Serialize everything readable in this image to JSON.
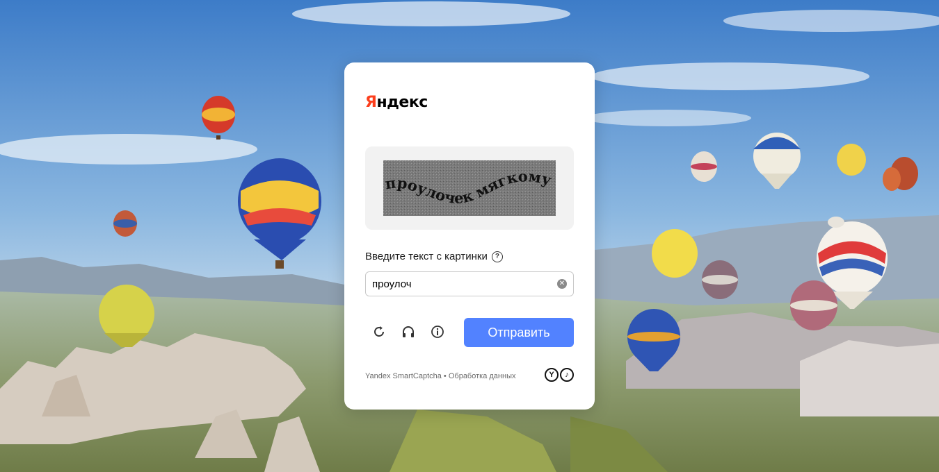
{
  "logo": {
    "first_letter": "Я",
    "rest": "ндекс",
    "accent_color": "#fc3f1d"
  },
  "captcha": {
    "image_text": "проулочек мягкому"
  },
  "prompt": {
    "label": "Введите текст с картинки",
    "help_icon": "question-circle-icon"
  },
  "input": {
    "value": "проулоч",
    "clear_icon": "clear-circle-icon"
  },
  "tools": [
    {
      "name": "refresh-icon"
    },
    {
      "name": "audio-headphones-icon"
    },
    {
      "name": "info-icon"
    }
  ],
  "submit": {
    "label": "Отправить",
    "color": "#5282ff"
  },
  "footer": {
    "brand": "Yandex SmartCaptcha",
    "separator": "•",
    "privacy_link": "Обработка данных"
  },
  "badges": [
    "Y",
    "♪"
  ]
}
